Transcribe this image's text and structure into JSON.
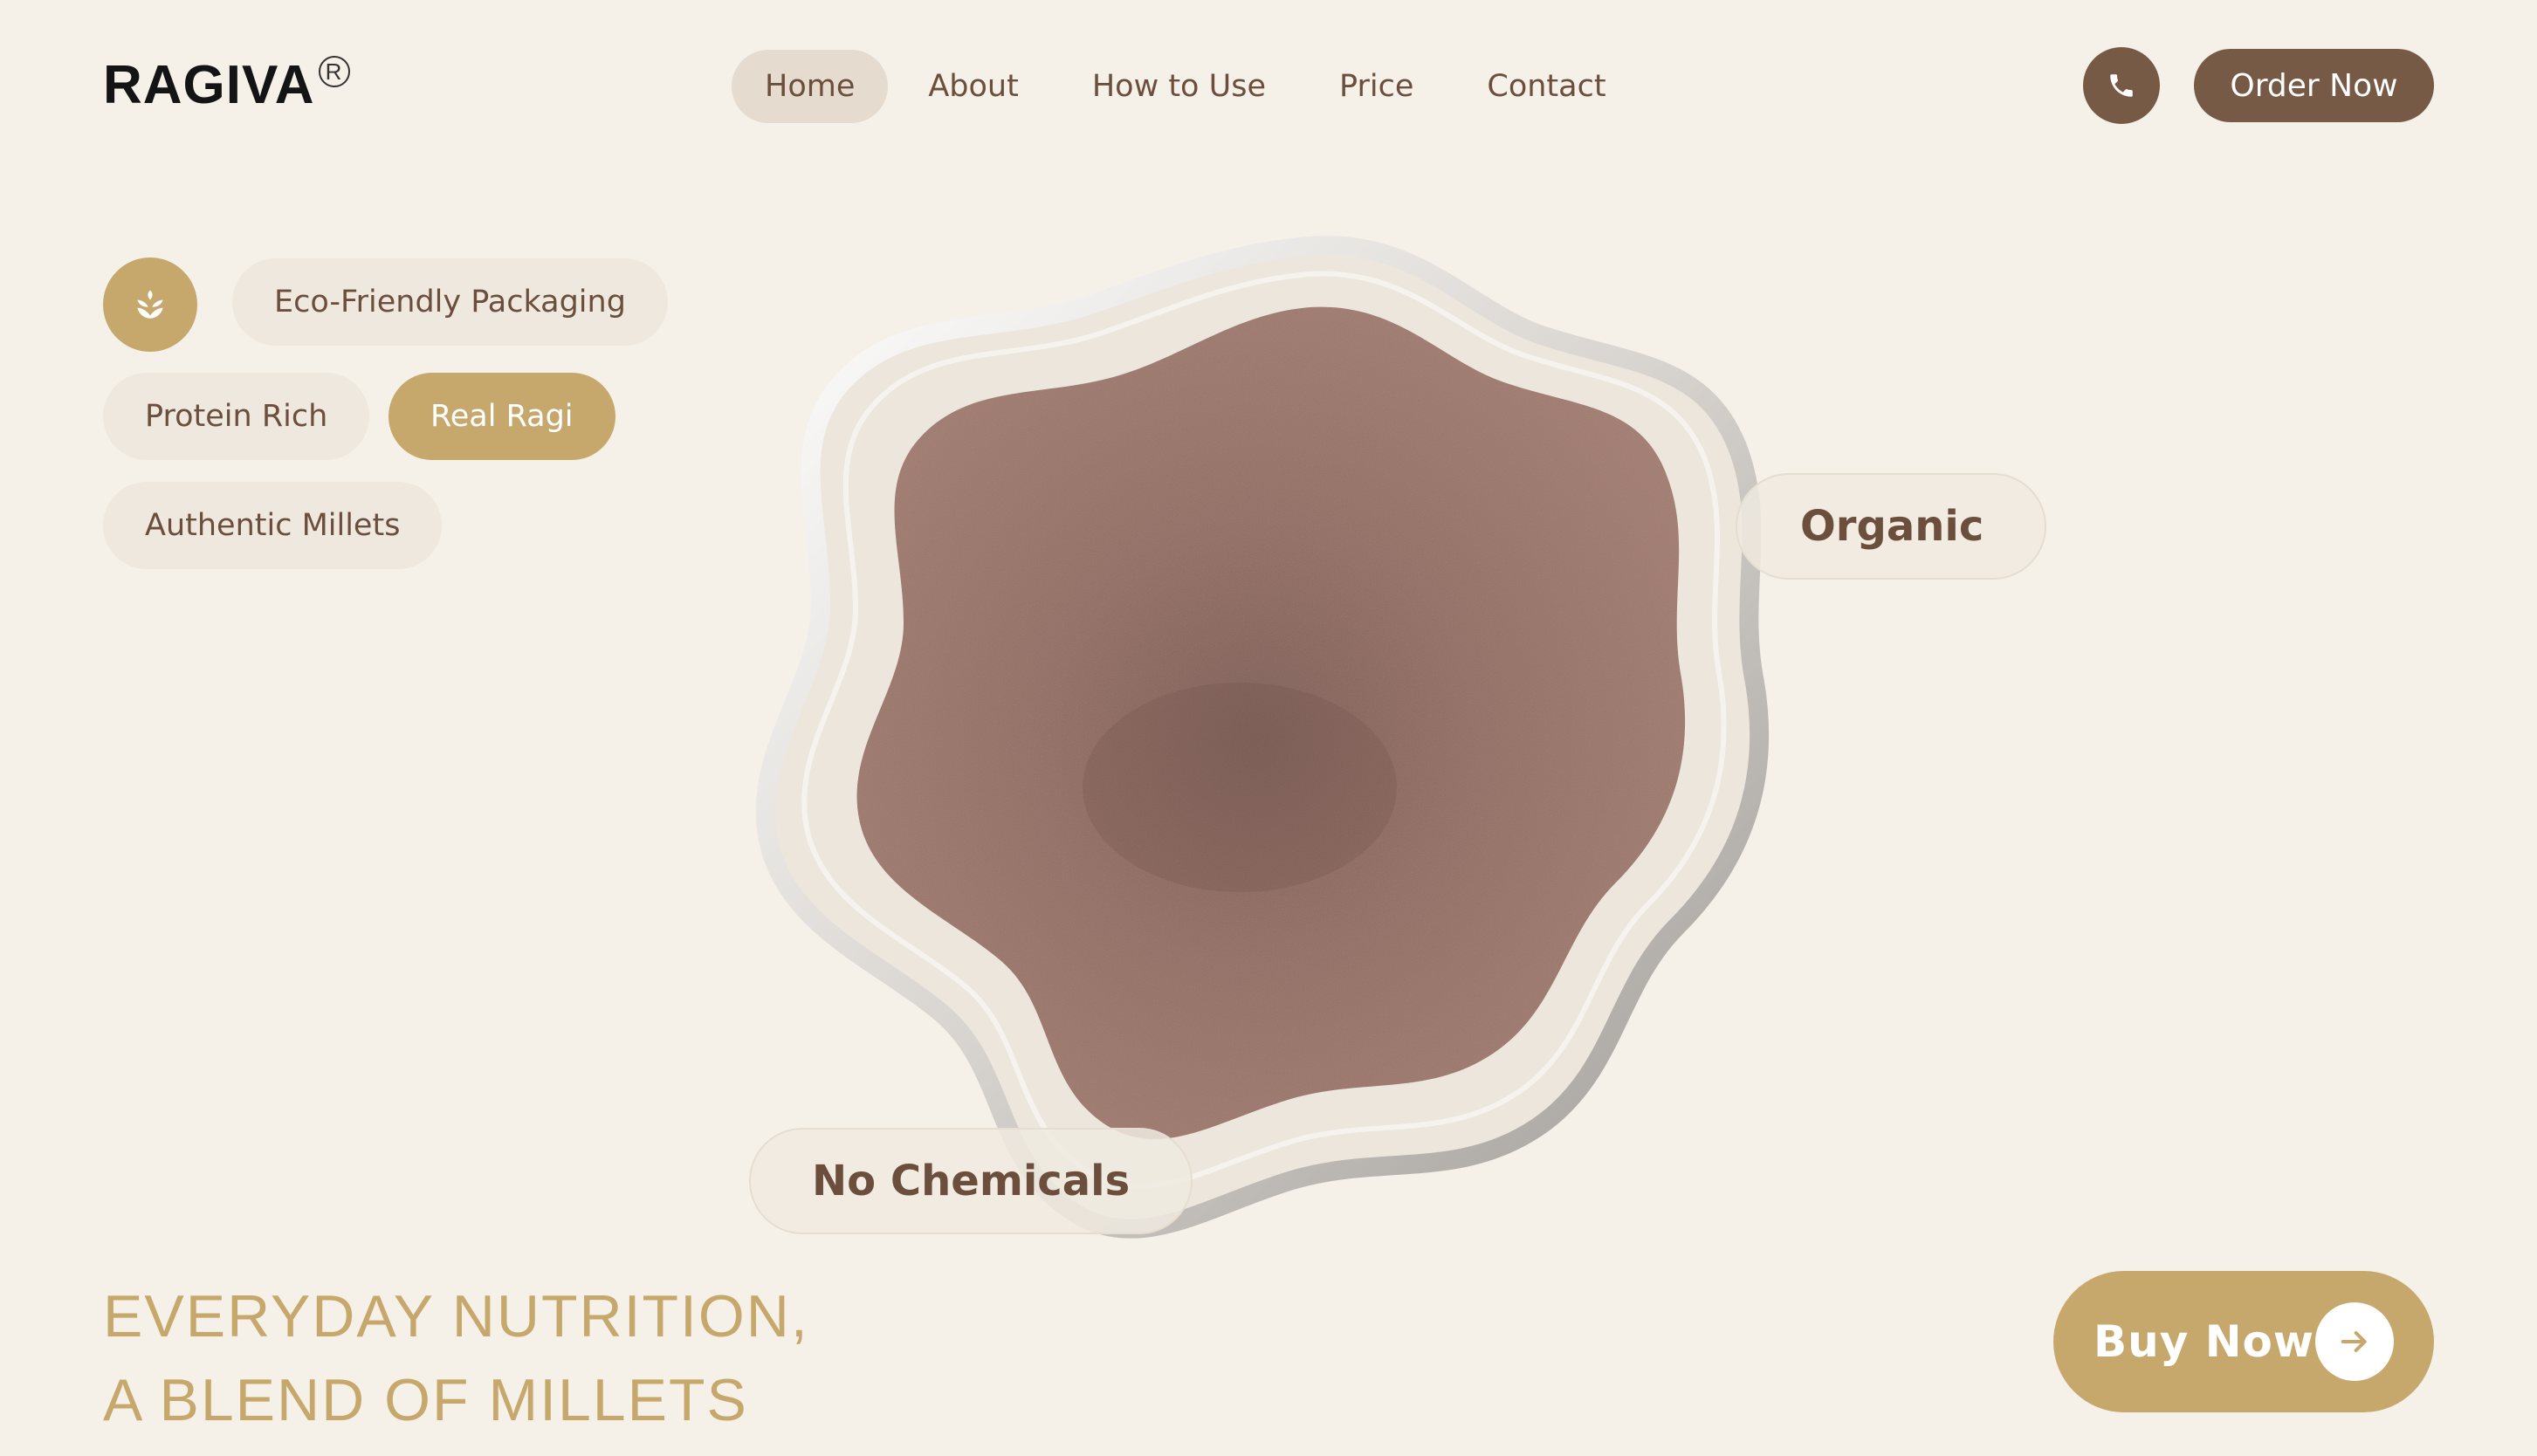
{
  "brand": {
    "name": "RAGIVA",
    "registered_mark": "R"
  },
  "nav": {
    "items": [
      {
        "label": "Home",
        "active": true
      },
      {
        "label": "About",
        "active": false
      },
      {
        "label": "How to Use",
        "active": false
      },
      {
        "label": "Price",
        "active": false
      },
      {
        "label": "Contact",
        "active": false
      }
    ]
  },
  "header": {
    "phone_icon": "phone-icon",
    "order_label": "Order Now"
  },
  "chips": {
    "eco": "Eco-Friendly Packaging",
    "protein": "Protein Rich",
    "ragi": "Real Ragi",
    "millets": "Authentic Millets"
  },
  "product": {
    "tags": {
      "organic": "Organic",
      "no_chemicals": "No Chemicals"
    }
  },
  "headline": {
    "line1": "EVERYDAY NUTRITION,",
    "line2": "A BLEND OF MILLETS"
  },
  "cta": {
    "buy_label": "Buy Now",
    "arrow_icon": "arrow-right-icon"
  },
  "colors": {
    "background": "#f5f0e8",
    "brown": "#765a45",
    "gold": "#c6a86c",
    "text": "#6b4f3c"
  }
}
